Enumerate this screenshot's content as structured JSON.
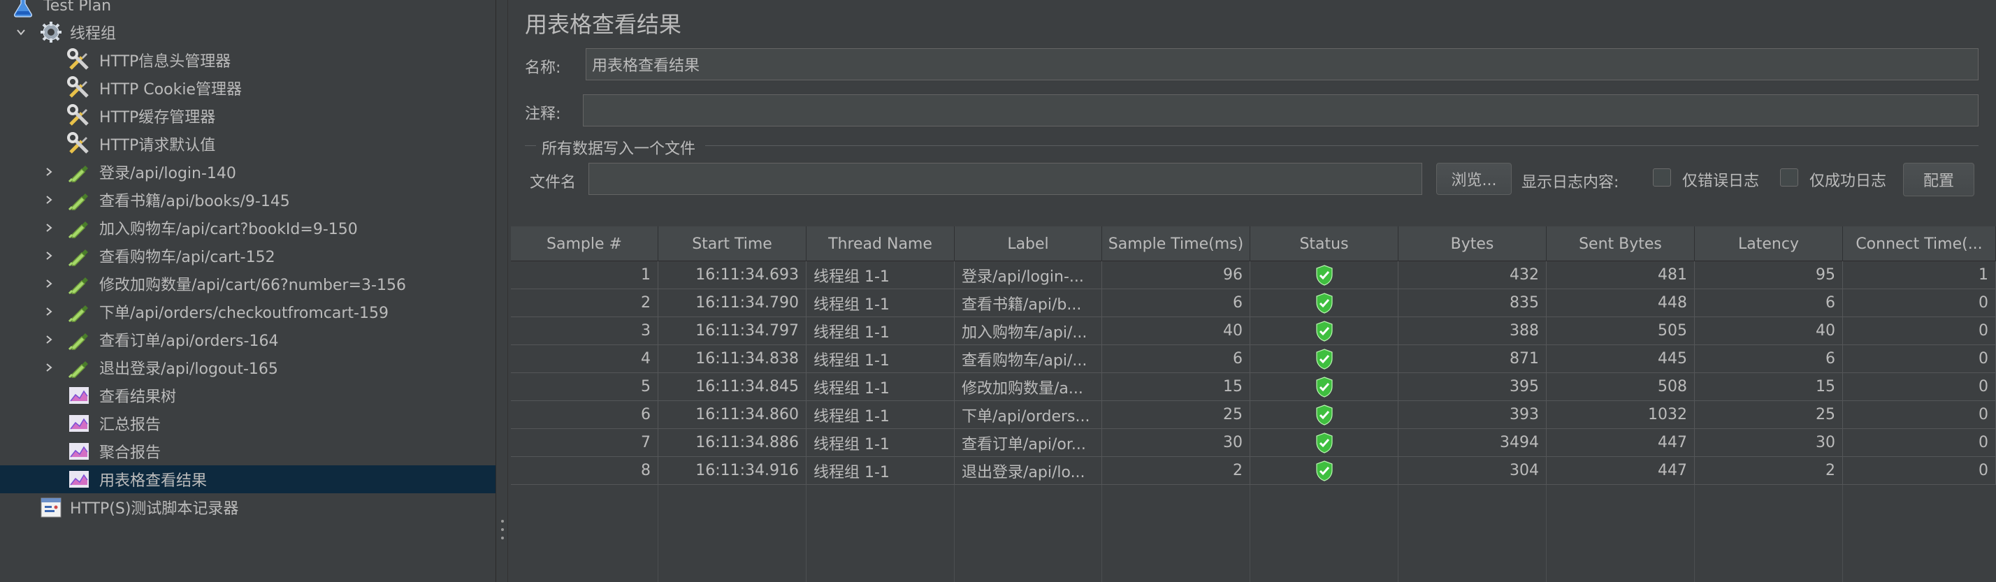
{
  "tree": {
    "items": [
      {
        "label": "Test Plan",
        "icon": "flask-icon"
      },
      {
        "label": "线程组",
        "icon": "gear-icon"
      },
      {
        "label": "HTTP信息头管理器",
        "icon": "wrench-screwdriver-icon"
      },
      {
        "label": "HTTP Cookie管理器",
        "icon": "wrench-screwdriver-icon"
      },
      {
        "label": "HTTP缓存管理器",
        "icon": "wrench-screwdriver-icon"
      },
      {
        "label": "HTTP请求默认值",
        "icon": "wrench-screwdriver-icon"
      },
      {
        "label": "登录/api/login-140",
        "icon": "pipette-icon"
      },
      {
        "label": "查看书籍/api/books/9-145",
        "icon": "pipette-icon"
      },
      {
        "label": "加入购物车/api/cart?bookId=9-150",
        "icon": "pipette-icon"
      },
      {
        "label": "查看购物车/api/cart-152",
        "icon": "pipette-icon"
      },
      {
        "label": "修改加购数量/api/cart/66?number=3-156",
        "icon": "pipette-icon"
      },
      {
        "label": "下单/api/orders/checkoutfromcart-159",
        "icon": "pipette-icon"
      },
      {
        "label": "查看订单/api/orders-164",
        "icon": "pipette-icon"
      },
      {
        "label": "退出登录/api/logout-165",
        "icon": "pipette-icon"
      },
      {
        "label": "查看结果树",
        "icon": "graph-icon"
      },
      {
        "label": "汇总报告",
        "icon": "graph-icon"
      },
      {
        "label": "聚合报告",
        "icon": "graph-icon"
      },
      {
        "label": "用表格查看结果",
        "icon": "graph-icon"
      },
      {
        "label": "HTTP(S)测试脚本记录器",
        "icon": "recorder-icon"
      }
    ],
    "selected_label": "用表格查看结果"
  },
  "panel": {
    "title": "用表格查看结果",
    "name_label": "名称:",
    "name_value": "用表格查看结果",
    "comment_label": "注释:",
    "comment_value": "",
    "file_group_label": "所有数据写入一个文件",
    "filename_label": "文件名",
    "filename_value": "",
    "browse_button": "浏览...",
    "log_content_label": "显示日志内容:",
    "errors_only_label": "仅错误日志",
    "success_only_label": "仅成功日志",
    "configure_button": "配置"
  },
  "table": {
    "columns": [
      "Sample #",
      "Start Time",
      "Thread Name",
      "Label",
      "Sample Time(ms)",
      "Status",
      "Bytes",
      "Sent Bytes",
      "Latency",
      "Connect Time(..."
    ],
    "rows": [
      {
        "sample": "1",
        "start": "16:11:34.693",
        "thread": "线程组 1-1",
        "label": "登录/api/login-...",
        "time": "96",
        "status": "success",
        "bytes": "432",
        "sent": "481",
        "latency": "95",
        "connect": "1"
      },
      {
        "sample": "2",
        "start": "16:11:34.790",
        "thread": "线程组 1-1",
        "label": "查看书籍/api/b...",
        "time": "6",
        "status": "success",
        "bytes": "835",
        "sent": "448",
        "latency": "6",
        "connect": "0"
      },
      {
        "sample": "3",
        "start": "16:11:34.797",
        "thread": "线程组 1-1",
        "label": "加入购物车/api/...",
        "time": "40",
        "status": "success",
        "bytes": "388",
        "sent": "505",
        "latency": "40",
        "connect": "0"
      },
      {
        "sample": "4",
        "start": "16:11:34.838",
        "thread": "线程组 1-1",
        "label": "查看购物车/api/...",
        "time": "6",
        "status": "success",
        "bytes": "871",
        "sent": "445",
        "latency": "6",
        "connect": "0"
      },
      {
        "sample": "5",
        "start": "16:11:34.845",
        "thread": "线程组 1-1",
        "label": "修改加购数量/a...",
        "time": "15",
        "status": "success",
        "bytes": "395",
        "sent": "508",
        "latency": "15",
        "connect": "0"
      },
      {
        "sample": "6",
        "start": "16:11:34.860",
        "thread": "线程组 1-1",
        "label": "下单/api/orders...",
        "time": "25",
        "status": "success",
        "bytes": "393",
        "sent": "1032",
        "latency": "25",
        "connect": "0"
      },
      {
        "sample": "7",
        "start": "16:11:34.886",
        "thread": "线程组 1-1",
        "label": "查看订单/api/or...",
        "time": "30",
        "status": "success",
        "bytes": "3494",
        "sent": "447",
        "latency": "30",
        "connect": "0"
      },
      {
        "sample": "8",
        "start": "16:11:34.916",
        "thread": "线程组 1-1",
        "label": "退出登录/api/lo...",
        "time": "2",
        "status": "success",
        "bytes": "304",
        "sent": "447",
        "latency": "2",
        "connect": "0"
      }
    ]
  },
  "colors": {
    "background": "#3c3f41",
    "selected_row": "#0d293e",
    "status_success": "#3fbf3f"
  }
}
